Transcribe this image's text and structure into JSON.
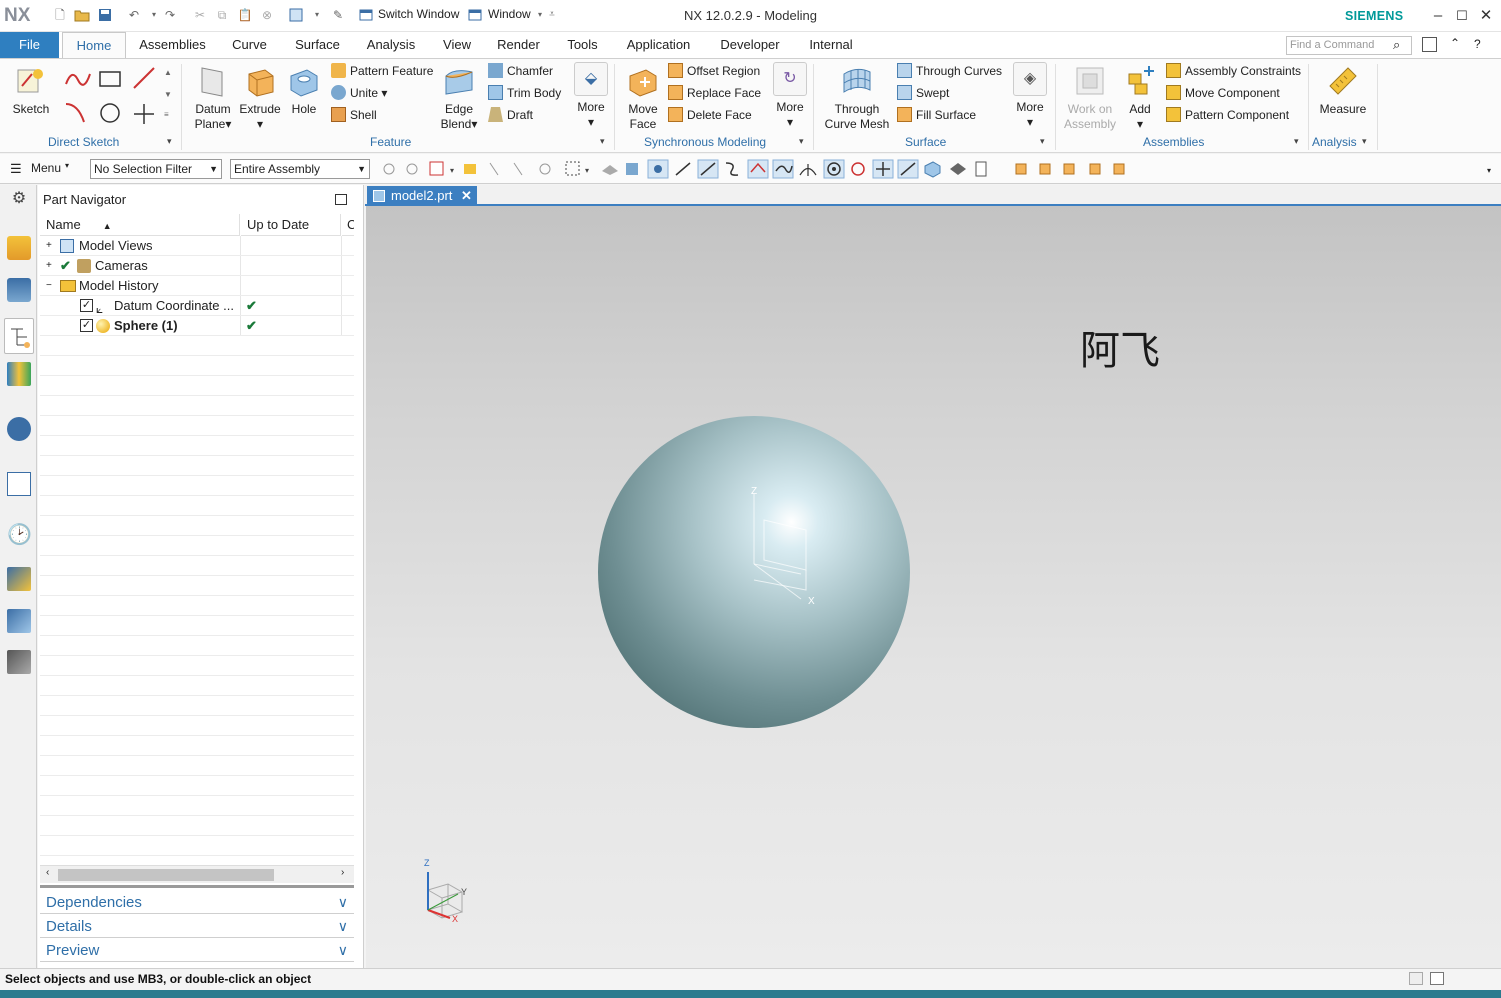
{
  "app": {
    "logo": "NX",
    "title": "NX 12.0.2.9 - Modeling",
    "brand": "SIEMENS",
    "brand_color": "#009999",
    "accent": "#2f7fc0"
  },
  "quick_access": {
    "switch_window": "Switch Window",
    "window": "Window"
  },
  "tabs": [
    {
      "label": "File"
    },
    {
      "label": "Home"
    },
    {
      "label": "Assemblies"
    },
    {
      "label": "Curve"
    },
    {
      "label": "Surface"
    },
    {
      "label": "Analysis"
    },
    {
      "label": "View"
    },
    {
      "label": "Render"
    },
    {
      "label": "Tools"
    },
    {
      "label": "Application"
    },
    {
      "label": "Developer"
    },
    {
      "label": "Internal"
    }
  ],
  "search": {
    "placeholder": "Find a Command"
  },
  "ribbon": {
    "direct_sketch": {
      "label": "Direct Sketch",
      "sketch": "Sketch"
    },
    "feature": {
      "label": "Feature",
      "datum_plane_1": "Datum",
      "datum_plane_2": "Plane",
      "extrude": "Extrude",
      "hole": "Hole",
      "pattern_feature": "Pattern Feature",
      "unite": "Unite",
      "shell": "Shell",
      "edge_blend_1": "Edge",
      "edge_blend_2": "Blend",
      "chamfer": "Chamfer",
      "trim_body": "Trim Body",
      "draft": "Draft",
      "more": "More"
    },
    "sync": {
      "label": "Synchronous Modeling",
      "move_face_1": "Move",
      "move_face_2": "Face",
      "offset_region": "Offset Region",
      "replace_face": "Replace Face",
      "delete_face": "Delete Face",
      "more": "More"
    },
    "surface": {
      "label": "Surface",
      "tcm_1": "Through",
      "tcm_2": "Curve Mesh",
      "through_curves": "Through Curves",
      "swept": "Swept",
      "fill_surface": "Fill Surface",
      "more": "More"
    },
    "assemblies": {
      "label": "Assemblies",
      "work_on_1": "Work on",
      "work_on_2": "Assembly",
      "add": "Add",
      "assembly_constraints": "Assembly Constraints",
      "move_component": "Move Component",
      "pattern_component": "Pattern Component"
    },
    "analysis": {
      "label": "Analysis",
      "measure": "Measure"
    }
  },
  "toolbar": {
    "menu": "Menu",
    "selection_filter": "No Selection Filter",
    "scope": "Entire Assembly"
  },
  "navigator": {
    "title": "Part Navigator",
    "col_name": "Name",
    "col_uptodate": "Up to Date",
    "col_c": "C",
    "rows": [
      {
        "label": "Model Views",
        "check": "",
        "bold": false
      },
      {
        "label": "Cameras",
        "check": "",
        "bold": false
      },
      {
        "label": "Model History",
        "check": "",
        "bold": false
      },
      {
        "label": "Datum Coordinate ...",
        "check": "✔",
        "bold": false
      },
      {
        "label": "Sphere (1)",
        "check": "✔",
        "bold": true
      }
    ],
    "panels": [
      {
        "label": "Dependencies"
      },
      {
        "label": "Details"
      },
      {
        "label": "Preview"
      }
    ]
  },
  "document": {
    "tab": "model2.prt",
    "watermark": "阿飞"
  },
  "triad": {
    "x": "X",
    "y": "Y",
    "z": "Z"
  },
  "status": {
    "message": "Select objects and use MB3, or double-click an object"
  }
}
